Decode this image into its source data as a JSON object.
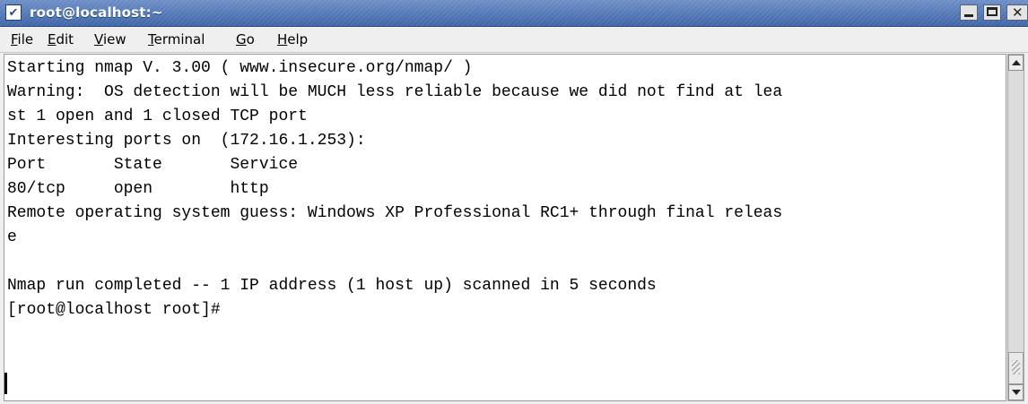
{
  "window": {
    "title": "root@localhost:~",
    "menu_glyph": "✔"
  },
  "menu": {
    "file": {
      "mnemonic": "F",
      "rest": "ile"
    },
    "edit": {
      "mnemonic": "E",
      "rest": "dit"
    },
    "view": {
      "mnemonic": "V",
      "rest": "iew"
    },
    "terminal": {
      "mnemonic": "T",
      "rest": "erminal"
    },
    "go": {
      "mnemonic": "G",
      "rest": "o"
    },
    "help": {
      "mnemonic": "H",
      "rest": "elp"
    }
  },
  "terminal": {
    "lines": [
      "Starting nmap V. 3.00 ( www.insecure.org/nmap/ )",
      "Warning:  OS detection will be MUCH less reliable because we did not find at lea",
      "st 1 open and 1 closed TCP port",
      "Interesting ports on  (172.16.1.253):",
      "Port       State       Service",
      "80/tcp     open        http",
      "Remote operating system guess: Windows XP Professional RC1+ through final releas",
      "e",
      "",
      "Nmap run completed -- 1 IP address (1 host up) scanned in 5 seconds",
      "[root@localhost root]#"
    ]
  },
  "colors": {
    "titlebar": "#4a70b0",
    "background": "#ffffff",
    "text": "#000000"
  }
}
